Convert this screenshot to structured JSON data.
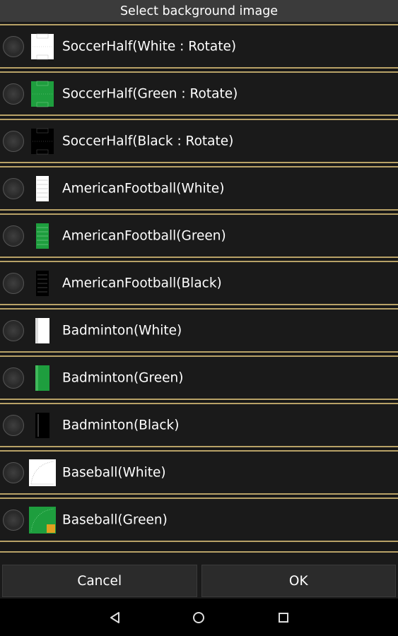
{
  "dialog": {
    "title": "Select background image",
    "cancel_label": "Cancel",
    "ok_label": "OK"
  },
  "items": [
    {
      "label": "SoccerHalf(White : Rotate)",
      "thumb": "soccer-white-icon"
    },
    {
      "label": "SoccerHalf(Green : Rotate)",
      "thumb": "soccer-green-icon"
    },
    {
      "label": "SoccerHalf(Black : Rotate)",
      "thumb": "soccer-black-icon"
    },
    {
      "label": "AmericanFootball(White)",
      "thumb": "football-white-icon"
    },
    {
      "label": "AmericanFootball(Green)",
      "thumb": "football-green-icon"
    },
    {
      "label": "AmericanFootball(Black)",
      "thumb": "football-black-icon"
    },
    {
      "label": "Badminton(White)",
      "thumb": "badminton-white-icon"
    },
    {
      "label": "Badminton(Green)",
      "thumb": "badminton-green-icon"
    },
    {
      "label": "Badminton(Black)",
      "thumb": "badminton-black-icon"
    },
    {
      "label": "Baseball(White)",
      "thumb": "baseball-white-icon"
    },
    {
      "label": "Baseball(Green)",
      "thumb": "baseball-green-icon"
    }
  ],
  "colors": {
    "divider": "#b8a267",
    "field_green": "#1e9e3e",
    "title_bar": "#3b3b3b"
  }
}
